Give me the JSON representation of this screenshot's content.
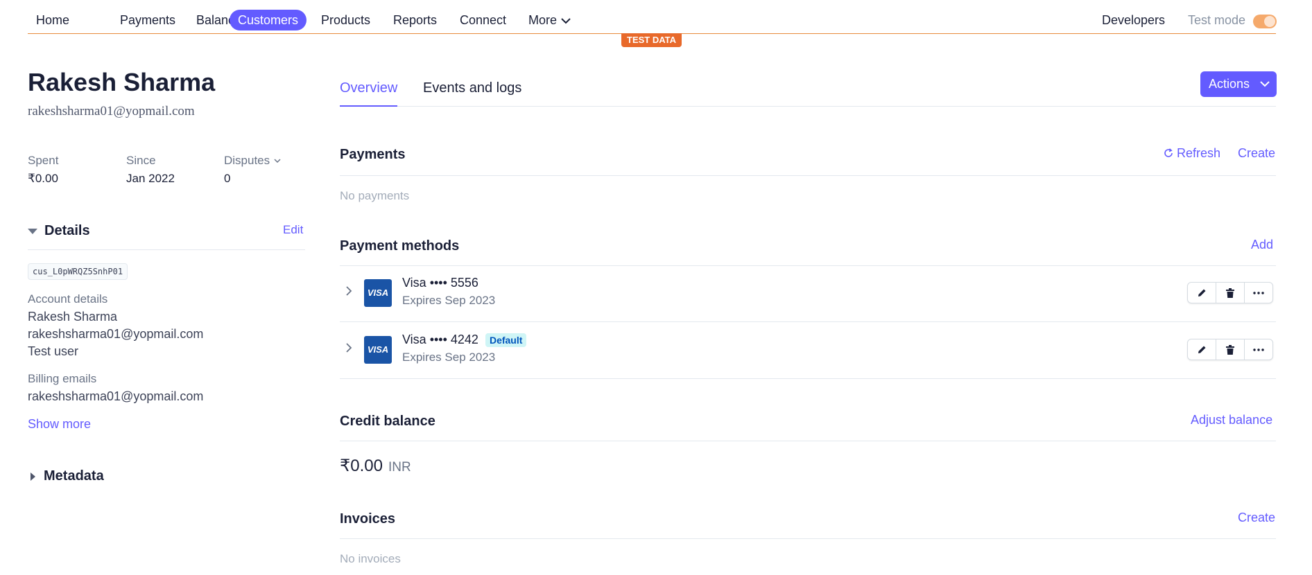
{
  "nav": {
    "items": [
      {
        "label": "Home"
      },
      {
        "label": "Payments"
      },
      {
        "label": "Balances"
      },
      {
        "label": "Customers"
      },
      {
        "label": "Products"
      },
      {
        "label": "Reports"
      },
      {
        "label": "Connect"
      },
      {
        "label": "More"
      }
    ],
    "active": "Customers",
    "developers": "Developers",
    "test_mode": "Test mode",
    "test_mode_on": true,
    "test_data_badge": "TEST DATA"
  },
  "customer": {
    "name": "Rakesh Sharma",
    "email": "rakeshsharma01@yopmail.com",
    "stats": [
      {
        "label": "Spent",
        "value": "₹0.00"
      },
      {
        "label": "Since",
        "value": "Jan 2022"
      },
      {
        "label": "Disputes",
        "value": "0"
      }
    ],
    "details": {
      "title": "Details",
      "edit": "Edit",
      "id": "cus_L0pWRQZ5SnhP01",
      "account_label": "Account details",
      "account_name": "Rakesh Sharma",
      "account_email": "rakeshsharma01@yopmail.com",
      "account_desc": "Test user",
      "billing_label": "Billing emails",
      "billing_email": "rakeshsharma01@yopmail.com",
      "show_more": "Show more"
    },
    "metadata_title": "Metadata"
  },
  "tabs": [
    {
      "label": "Overview",
      "active": true
    },
    {
      "label": "Events and logs",
      "active": false
    }
  ],
  "actions_label": "Actions",
  "payments": {
    "title": "Payments",
    "refresh": "Refresh",
    "create": "Create",
    "empty": "No payments"
  },
  "payment_methods": {
    "title": "Payment methods",
    "add": "Add",
    "cards": [
      {
        "logo": "VISA",
        "brand": "Visa •••• 5556",
        "expires": "Expires Sep 2023",
        "default": ""
      },
      {
        "logo": "VISA",
        "brand": "Visa •••• 4242",
        "expires": "Expires Sep 2023",
        "default": "Default"
      }
    ]
  },
  "credit_balance": {
    "title": "Credit balance",
    "adjust": "Adjust balance",
    "amount": "₹0.00",
    "currency": "INR"
  },
  "invoices": {
    "title": "Invoices",
    "create": "Create",
    "empty": "No invoices"
  },
  "colors": {
    "accent": "#635bff",
    "test_orange": "#e8692a",
    "visa_blue": "#1a54a6"
  }
}
